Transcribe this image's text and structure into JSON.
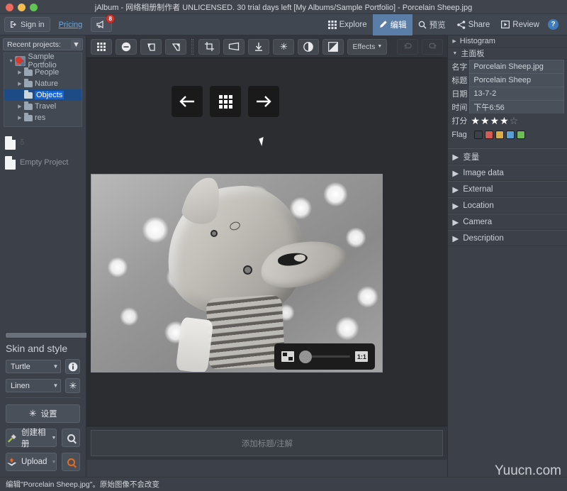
{
  "window": {
    "title": "jAlbum - 网络相册制作者 UNLICENSED. 30 trial days left [My Albums/Sample Portfolio] - Porcelain Sheep.jpg"
  },
  "account_bar": {
    "sign_in": "Sign in",
    "pricing": "Pricing",
    "notification_count": "8",
    "nav": [
      {
        "label": "Explore",
        "icon": "grid-icon",
        "active": false
      },
      {
        "label": "编辑",
        "icon": "pencil-icon",
        "active": true
      },
      {
        "label": "预览",
        "icon": "search-icon",
        "active": false
      },
      {
        "label": "Share",
        "icon": "share-icon",
        "active": false
      },
      {
        "label": "Review",
        "icon": "play-icon",
        "active": false
      }
    ],
    "help": "?"
  },
  "sidebar": {
    "recent_projects_label": "Recent projects:",
    "tree": [
      {
        "label": "Sample Portfolio",
        "depth": 0,
        "icon": "poppy-thumb",
        "expanded": true,
        "selected": false
      },
      {
        "label": "People",
        "depth": 1,
        "icon": "folder-icon",
        "expanded": false,
        "selected": false
      },
      {
        "label": "Nature",
        "depth": 1,
        "icon": "folder-icon",
        "expanded": false,
        "selected": false
      },
      {
        "label": "Objects",
        "depth": 1,
        "icon": "folder-icon",
        "expanded": false,
        "selected": true
      },
      {
        "label": "Travel",
        "depth": 1,
        "icon": "folder-icon",
        "expanded": false,
        "selected": false
      },
      {
        "label": "res",
        "depth": 1,
        "icon": "folder-icon",
        "expanded": false,
        "selected": false
      }
    ],
    "files": [
      {
        "label": "δ",
        "icon": "document-icon",
        "faint": true
      },
      {
        "label": "Empty Project",
        "icon": "document-icon",
        "faint": false
      }
    ],
    "skin_section": {
      "title": "Skin and style",
      "skin_value": "Turtle",
      "style_value": "Linen",
      "info_icon": "info-icon",
      "settings_icon": "gear-icon",
      "settings_button": "设置",
      "make_album_button": "创建相册",
      "upload_button": "Upload",
      "preview_icon": "magnifier-icon",
      "preview_online_icon": "magnifier-orange-icon"
    }
  },
  "toolbar": {
    "buttons": [
      {
        "name": "grid-view",
        "icon": "grid-icon",
        "label": "",
        "disabled": false
      },
      {
        "name": "remove",
        "icon": "minus-circle-icon",
        "label": "",
        "disabled": false
      },
      {
        "name": "rotate-left",
        "icon": "rotate-left-icon",
        "label": "",
        "disabled": false
      },
      {
        "name": "rotate-right",
        "icon": "rotate-right-icon",
        "label": "",
        "disabled": false
      },
      {
        "name": "crop",
        "icon": "crop-icon",
        "label": "",
        "disabled": false
      },
      {
        "name": "perspective",
        "icon": "perspective-icon",
        "label": "",
        "disabled": false
      },
      {
        "name": "sharpen",
        "icon": "sharpen-icon",
        "label": "",
        "disabled": false
      },
      {
        "name": "adjust",
        "icon": "gear-icon",
        "label": "",
        "disabled": false
      },
      {
        "name": "contrast",
        "icon": "contrast-icon",
        "label": "",
        "disabled": false
      },
      {
        "name": "exposure",
        "icon": "exposure-icon",
        "label": "",
        "disabled": false
      },
      {
        "name": "effects",
        "icon": "chevron-down-icon",
        "label": "Effects",
        "disabled": false
      },
      {
        "name": "undo",
        "icon": "undo-icon",
        "label": "",
        "disabled": true
      },
      {
        "name": "redo",
        "icon": "redo-icon",
        "label": "",
        "disabled": true
      }
    ],
    "effects_label": "Effects"
  },
  "canvas": {
    "prev_label": "←",
    "grid_label": "grid",
    "next_label": "→",
    "zoom": {
      "fit_label": "fit",
      "one_to_one_label": "1:1",
      "value": 0
    },
    "caption_placeholder": "添加标题/注解",
    "center_status": ""
  },
  "right_panel": {
    "histogram": {
      "label": "Histogram",
      "expanded": false
    },
    "main_panel": {
      "label": "主面板",
      "expanded": true
    },
    "fields": [
      {
        "key": "名字",
        "value": "Porcelain Sheep.jpg"
      },
      {
        "key": "标题",
        "value": "Porcelain Sheep"
      },
      {
        "key": "日期",
        "value": "13-7-2"
      },
      {
        "key": "时间",
        "value": "下午6:56"
      }
    ],
    "rating": {
      "key": "打分",
      "filled": 4,
      "total": 5
    },
    "flag": {
      "key": "Flag",
      "colors": [
        "#3b4049",
        "#d35b55",
        "#d8ad4b",
        "#5a9ed6",
        "#6fbb57"
      ],
      "selected_index": 0
    },
    "sections": [
      {
        "label": "变量",
        "expanded": false
      },
      {
        "label": "Image data",
        "expanded": false
      },
      {
        "label": "External",
        "expanded": false
      },
      {
        "label": "Location",
        "expanded": false
      },
      {
        "label": "Camera",
        "expanded": false
      },
      {
        "label": "Description",
        "expanded": false
      }
    ]
  },
  "statusbar": {
    "text": "编辑\"Porcelain Sheep.jpg\"。原始图像不会改变"
  },
  "watermark": {
    "text": "Yuucn.com"
  },
  "colors": {
    "accent_blue": "#5b7ea8",
    "selection_blue": "#1565d8",
    "link_blue": "#6aa9e0",
    "badge_red": "#d5352d",
    "panel_bg": "#3b4049",
    "canvas_bg": "#2b2d31"
  }
}
